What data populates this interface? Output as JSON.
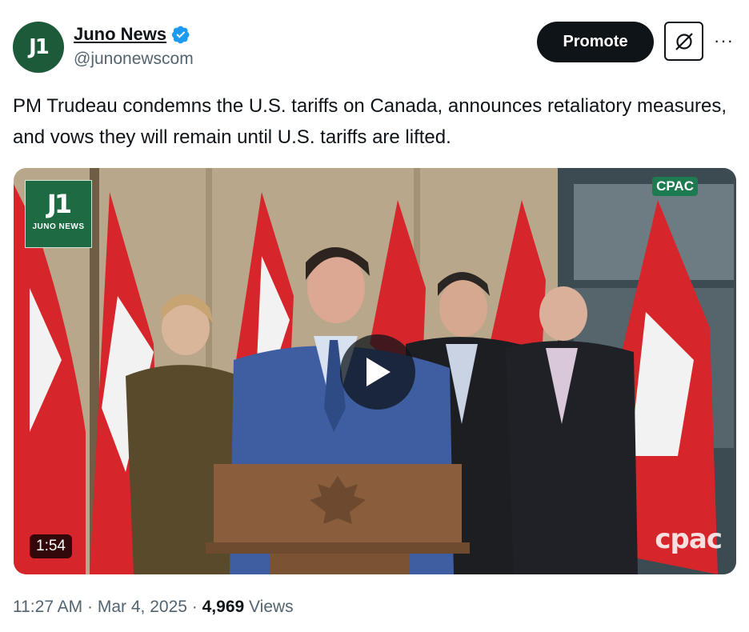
{
  "author": {
    "avatar_text": "J‍1",
    "display_name": "Juno News",
    "handle": "@junonewscom",
    "verified_icon": "verified-badge-icon",
    "verified_color": "#1d9bf0",
    "avatar_color": "#1d5a3a"
  },
  "actions": {
    "promote_label": "Promote",
    "grok_icon": "grok-icon",
    "more_label": "···"
  },
  "tweet": {
    "text": "PM Trudeau condemns the U.S. tariffs on Canada, announces retaliatory measures, and vows they will remain until U.S. tariffs are lifted."
  },
  "video": {
    "logo_mark": "J‍1",
    "logo_text": "JUNO NEWS",
    "cpac_badge": "CPAC",
    "watermark": "cpac",
    "duration": "1:54",
    "play_icon": "play-icon"
  },
  "meta": {
    "time": "11:27 AM",
    "separator": "·",
    "date": "Mar 4, 2025",
    "views_count": "4,969",
    "views_label": "Views"
  }
}
